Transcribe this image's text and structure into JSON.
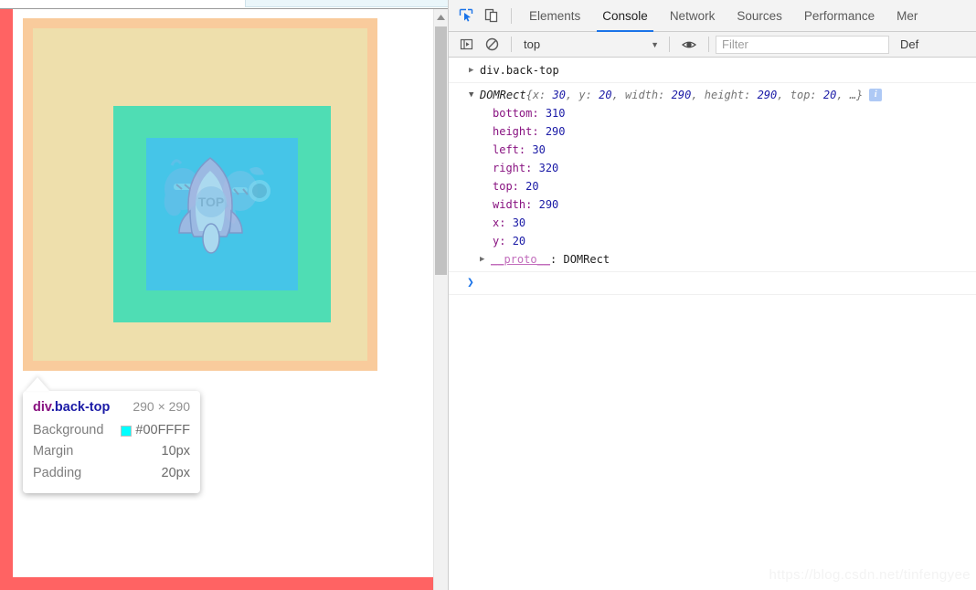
{
  "browser": {
    "tab_fragment": "browser-tab-fragment"
  },
  "page": {
    "border_color": "#FF6363",
    "margin_color": "#F9CB9C",
    "padding_color": "#EEDFAC",
    "green_color": "#4FDDB4",
    "content_color": "#45C5E8",
    "rocket_label": "TOP"
  },
  "inspector_tooltip": {
    "element_tag": "div",
    "element_class": ".back-top",
    "dimensions": "290 × 290",
    "rows": [
      {
        "label": "Background",
        "value": "#00FFFF",
        "swatch": "#00FFFF"
      },
      {
        "label": "Margin",
        "value": "10px",
        "swatch": null
      },
      {
        "label": "Padding",
        "value": "20px",
        "swatch": null
      }
    ]
  },
  "devtools": {
    "inspect_icon": "inspect-element-icon",
    "device_icon": "device-toolbar-icon",
    "tabs": [
      {
        "label": "Elements",
        "selected": false
      },
      {
        "label": "Console",
        "selected": true
      },
      {
        "label": "Network",
        "selected": false
      },
      {
        "label": "Sources",
        "selected": false
      },
      {
        "label": "Performance",
        "selected": false
      },
      {
        "label": "Mer",
        "selected": false
      }
    ],
    "filterbar": {
      "sidebar_icon": "console-sidebar-icon",
      "clear_icon": "clear-console-icon",
      "context": "top",
      "eye_icon": "live-expression-eye-icon",
      "filter_placeholder": "Filter",
      "filter_value": "",
      "level": "Def"
    },
    "console": {
      "entry1": {
        "expander": "▶",
        "text": "div.back-top"
      },
      "entry2": {
        "expander": "▼",
        "type": "DOMRect",
        "preview_open": "{",
        "preview": [
          {
            "key": "x:",
            "value": "30"
          },
          {
            "key": "y:",
            "value": "20"
          },
          {
            "key": "width:",
            "value": "290"
          },
          {
            "key": "height:",
            "value": "290"
          },
          {
            "key": "top:",
            "value": "20"
          }
        ],
        "preview_ellipsis": "…}",
        "info_badge": "i",
        "properties": [
          {
            "key": "bottom:",
            "value": "310"
          },
          {
            "key": "height:",
            "value": "290"
          },
          {
            "key": "left:",
            "value": "30"
          },
          {
            "key": "right:",
            "value": "320"
          },
          {
            "key": "top:",
            "value": "20"
          },
          {
            "key": "width:",
            "value": "290"
          },
          {
            "key": "x:",
            "value": "30"
          },
          {
            "key": "y:",
            "value": "20"
          }
        ],
        "proto_expander": "▶",
        "proto_key": "__proto__",
        "proto_value": ": DOMRect"
      },
      "prompt_caret": "❯"
    }
  },
  "watermark": "https://blog.csdn.net/tinfengyee"
}
